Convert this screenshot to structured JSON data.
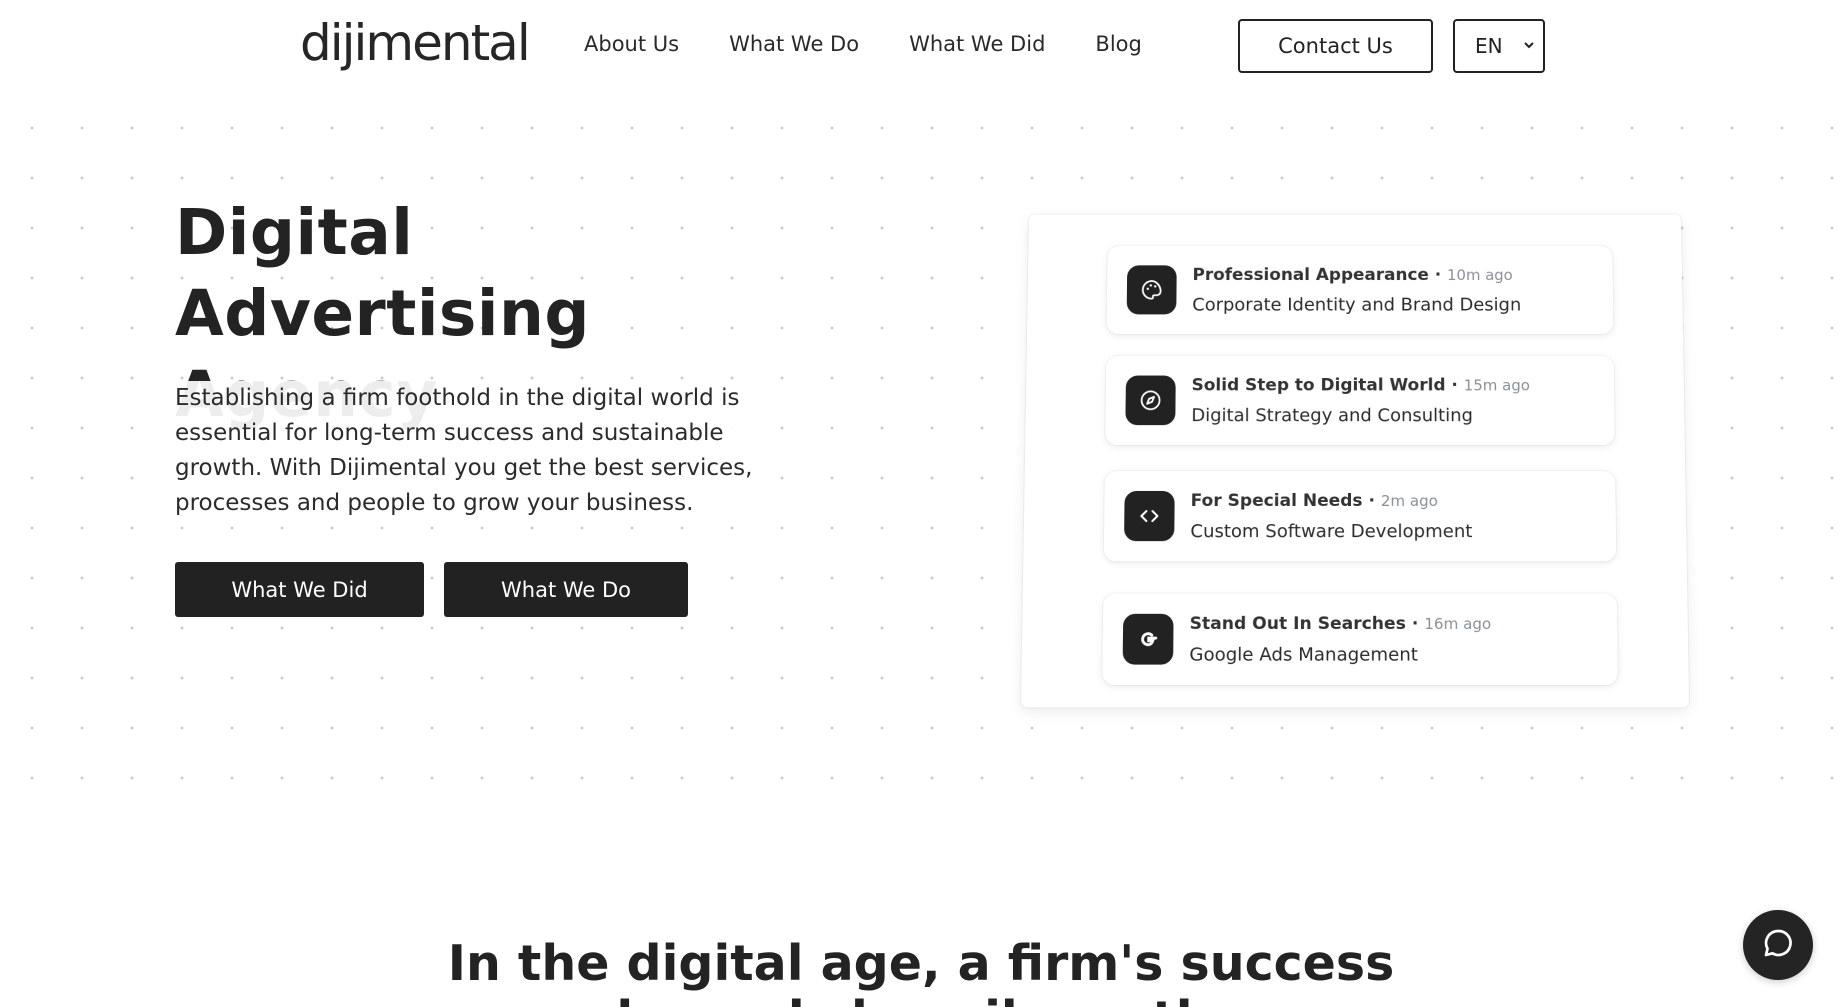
{
  "header": {
    "logo": "dijimental",
    "nav": [
      "About Us",
      "What We Do",
      "What We Did",
      "Blog"
    ],
    "contact_label": "Contact Us",
    "language": "EN"
  },
  "hero": {
    "title_line1": "Digital",
    "title_line2": "Advertising Agency",
    "description": "Establishing a firm foothold in the digital world is essential for long-term success and sustainable growth. With Dijimental you get the best services, processes and people to grow your business.",
    "btn_primary": "What We Did",
    "btn_secondary": "What We Do"
  },
  "cards": [
    {
      "title": "Professional Appearance",
      "ago": "10m ago",
      "subtitle": "Corporate Identity and Brand Design",
      "icon": "palette-icon"
    },
    {
      "title": "Solid Step to Digital World",
      "ago": "15m ago",
      "subtitle": "Digital Strategy and Consulting",
      "icon": "compass-icon"
    },
    {
      "title": "For Special Needs",
      "ago": "2m ago",
      "subtitle": "Custom Software Development",
      "icon": "code-icon"
    },
    {
      "title": "Stand Out In Searches",
      "ago": "16m ago",
      "subtitle": "Google Ads Management",
      "icon": "google-icon"
    }
  ],
  "section2": {
    "heading_line1": "In the digital age, a firm's success",
    "heading_line2": "depends heavily on the"
  },
  "colors": {
    "dark": "#222222",
    "background": "#ffffff",
    "muted": "#8a8f98"
  }
}
